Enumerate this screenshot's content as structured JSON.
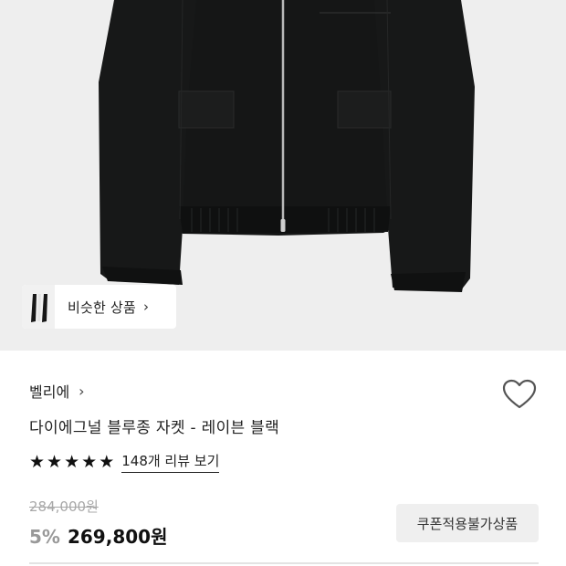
{
  "product_image": {
    "alt": "black zip-up blouson jacket"
  },
  "similar": {
    "label": "비슷한 상품",
    "chevron": "›"
  },
  "brand": {
    "name": "벨리에",
    "chevron": "›"
  },
  "wishlist": {
    "icon": "heart-outline-icon"
  },
  "product": {
    "title": "다이에그널 블루종 자켓 - 레이븐 블랙"
  },
  "rating": {
    "stars": 5,
    "star_char": "★",
    "reviews_label": "148개 리뷰 보기"
  },
  "price": {
    "original": "284,000원",
    "discount": "5%",
    "sale": "269,800원"
  },
  "coupon": {
    "label": "쿠폰적용불가상품"
  },
  "colors": {
    "hero_bg": "#eeeeee",
    "jacket": "#141515",
    "text": "#222222",
    "muted": "#999999"
  }
}
